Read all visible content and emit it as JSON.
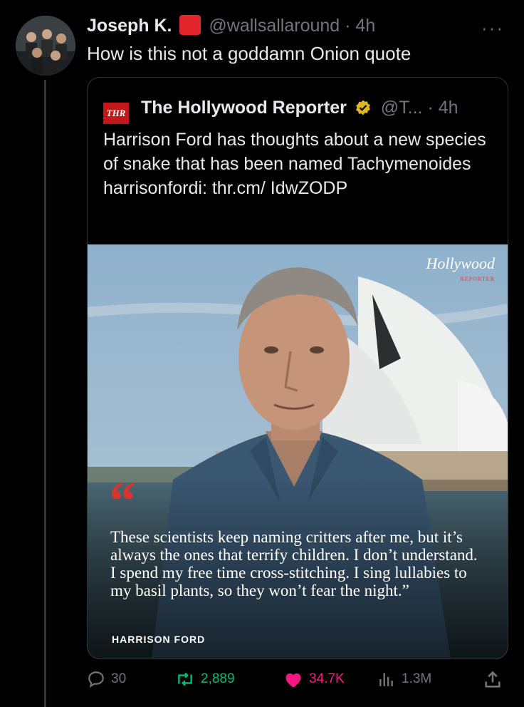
{
  "tweet": {
    "author_name": "Joseph K.",
    "author_handle": "@wallsallaround",
    "time": "· 4h",
    "text": "How is this not a goddamn Onion quote",
    "more_glyph": "···"
  },
  "quoted": {
    "logo_text": "THR",
    "author_name": "The Hollywood Reporter",
    "handle": "@T...",
    "time": "· 4h",
    "text": "Harrison Ford has thoughts about a new species of snake that has been named Tachymenoides harrisonfordi: thr.cm/ IdwZODP",
    "media": {
      "magazine_logo": "Hollywood",
      "magazine_sub": "REPORTER",
      "quote_mark": "“",
      "quote": "These scientists keep naming critters after me, but it’s always the ones that terrify children. I don’t understand. I spend my free time cross-stitching. I sing lullabies to my basil plants, so they won’t fear the night.”",
      "attribution": "HARRISON FORD"
    }
  },
  "actions": {
    "replies": "30",
    "reposts": "2,889",
    "likes": "34.7K",
    "views": "1.3M"
  },
  "colors": {
    "background": "#000000",
    "text": "#e7e9ea",
    "muted": "#71767b",
    "repost": "#00ba7c",
    "like": "#f91880",
    "thr_red": "#c4171c"
  },
  "icons": [
    "reply-icon",
    "repost-icon",
    "like-icon",
    "views-icon",
    "share-icon",
    "verified-icon",
    "more-icon"
  ]
}
